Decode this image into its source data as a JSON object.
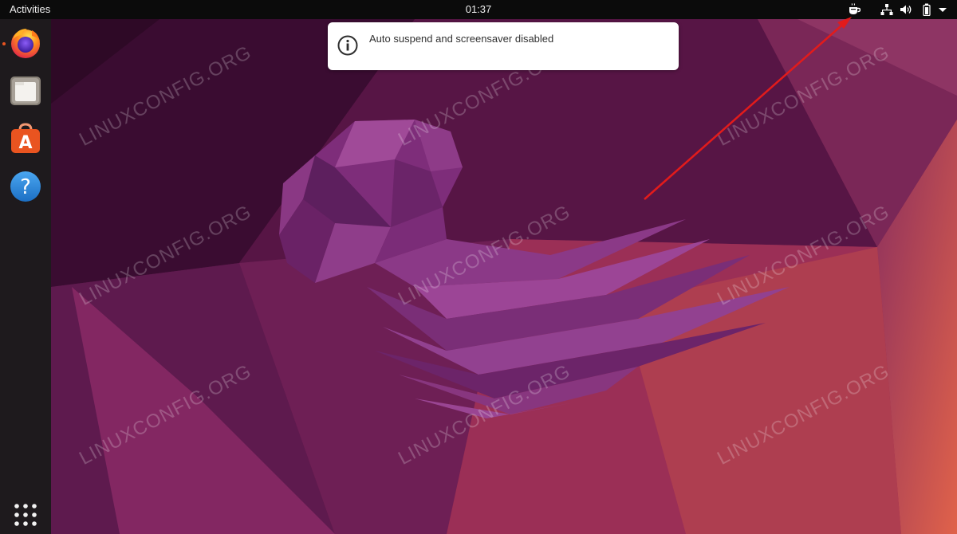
{
  "topbar": {
    "activities_label": "Activities",
    "clock": "01:37",
    "tray_icons": [
      "caffeine-icon",
      "network-icon",
      "volume-icon",
      "battery-icon",
      "system-menu-arrow-icon"
    ]
  },
  "dock": {
    "apps": [
      {
        "name": "firefox-icon",
        "running": true
      },
      {
        "name": "files-icon",
        "running": false
      },
      {
        "name": "ubuntu-software-icon",
        "running": false
      },
      {
        "name": "help-icon",
        "running": false
      }
    ],
    "show_apps_icon": "show-applications-icon",
    "help_glyph": "?",
    "software_glyph": "A"
  },
  "notification": {
    "icon": "info-icon",
    "message": "Auto suspend and screensaver disabled"
  },
  "watermark": {
    "text": "LINUXCONFIG.ORG"
  },
  "colors": {
    "accent": "#e95420",
    "arrow": "#e21b1b",
    "panel": "#0b0b0b",
    "dock": "#1e1a1d"
  }
}
